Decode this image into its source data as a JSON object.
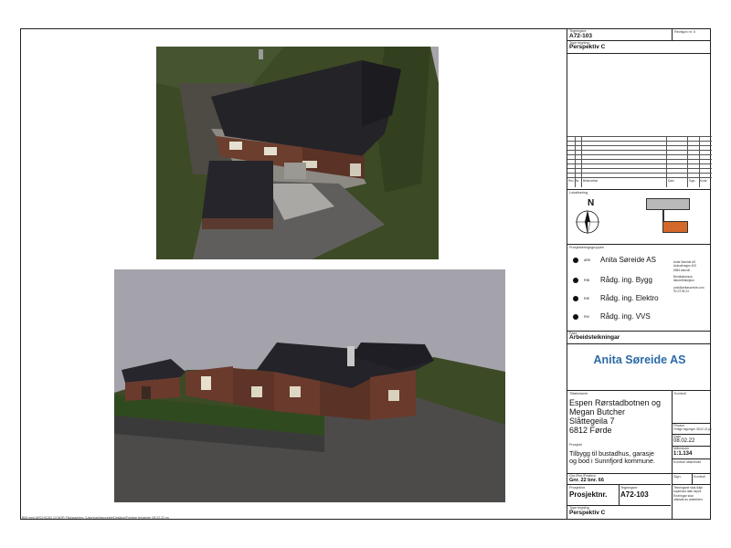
{
  "title_block": {
    "drawing_no_label": "Tegningsnr.",
    "drawing_no": "A72-103",
    "revision_label": "Revisjon nr. 0",
    "drawing_type_label": "Type tegning",
    "drawing_type": "Perspektiv C",
    "revision_table_headers": [
      "Rev.",
      "Nr.",
      "Beskrivelse",
      "Dato",
      "Sign.",
      "Kontr."
    ],
    "location_label": "Lokalisering",
    "north_label": "N",
    "design_group_label": "Prosjekteringsgruppen",
    "roles": [
      {
        "code": "ARK",
        "name": "Anita Søreide AS"
      },
      {
        "code": "RIB",
        "name": "Rådg. ing. Bygg"
      },
      {
        "code": "RIE",
        "name": "Rådg. ing. Elektro"
      },
      {
        "code": "RIV",
        "name": "Rådg. ing. VVS"
      }
    ],
    "firm_info_lines": [
      "Anita Søreide AS",
      "Askvollvegen 400",
      "6984 Askvoll",
      "",
      "Breakskolvsva",
      "itakvollfrakvgtun",
      "",
      "post@anitasoreide.com",
      "90 23 95 24"
    ],
    "phase_label": "Fase",
    "phase": "Arbeidsteikningar",
    "brand": "Anita Søreide AS",
    "client_label": "Tiltakshaver",
    "control_label": "Kontroll",
    "client_lines": [
      "Espen Rørstadbotnen og",
      "Megan Butcher",
      "Slåttegeila 7",
      "6812 Førde"
    ],
    "project_label": "Prosjekt",
    "project_lines": [
      "Tilbygg til bustadhus, garasje",
      "og bod i Sunnfjord kommune."
    ],
    "file_label": "Filnavn",
    "file_value": "Fertige tegninger 08.02.22.pn",
    "date_label": "Dato",
    "date": "08.02.22",
    "scale_label": "Målestokk",
    "scale": "1:1.134",
    "control_done_label": "Kontroll utførende",
    "sign_label": "Sign.",
    "control_label2": "Kontroll",
    "gnr_label": "Gnr./Bnr./Festenr.",
    "gnr": "Gnr. 22 bnr. 66",
    "copyright_note": [
      "Tekningane skal ikkje",
      "kopierast utan løyve.",
      "Endringar skal",
      "utførast av arkitekten."
    ],
    "project_no_label": "Prosjektnr.",
    "project_no": "Prosjektnr.",
    "drawing_no_label2": "Tegningsnr.",
    "drawing_no2": "A72-103",
    "drawing_type_label2": "Type tegning",
    "drawing_type2": "Perspektiv C"
  },
  "footnote": "BIM med ARCHICAD 24 NOR    Filplassering: \\Users\\anitasoreide\\Desktop\\Ferdige tekninger 08.02.22.pn",
  "colors": {
    "brand": "#2c6aa6",
    "roof": "#222228",
    "wall_brick": "#6a3a2c",
    "grass": "#3d4a26",
    "sky": "#a4a2ab",
    "location_box_top": "#b9b9b9",
    "location_box_bottom": "#d2692a"
  }
}
